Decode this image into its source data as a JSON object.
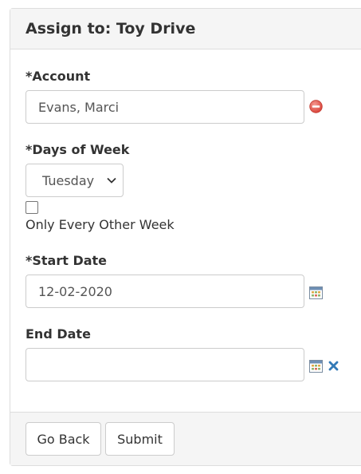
{
  "panel": {
    "title": "Assign to: Toy Drive"
  },
  "form": {
    "account": {
      "label": "*Account",
      "value": "Evans, Marci",
      "remove_icon": "minus-circle-icon"
    },
    "days_of_week": {
      "label": "*Days of Week",
      "selected": "Tuesday"
    },
    "every_other_week": {
      "label": "Only Every Other Week",
      "checked": false
    },
    "start_date": {
      "label": "*Start Date",
      "value": "12-02-2020",
      "calendar_icon": "calendar-icon"
    },
    "end_date": {
      "label": "End Date",
      "value": "",
      "calendar_icon": "calendar-icon",
      "clear_icon": "close-icon"
    }
  },
  "footer": {
    "back_label": "Go Back",
    "submit_label": "Submit"
  },
  "colors": {
    "remove_red": "#e2574c",
    "clear_blue": "#337ab7",
    "header_bg": "#f5f5f5",
    "border": "#dddddd"
  }
}
